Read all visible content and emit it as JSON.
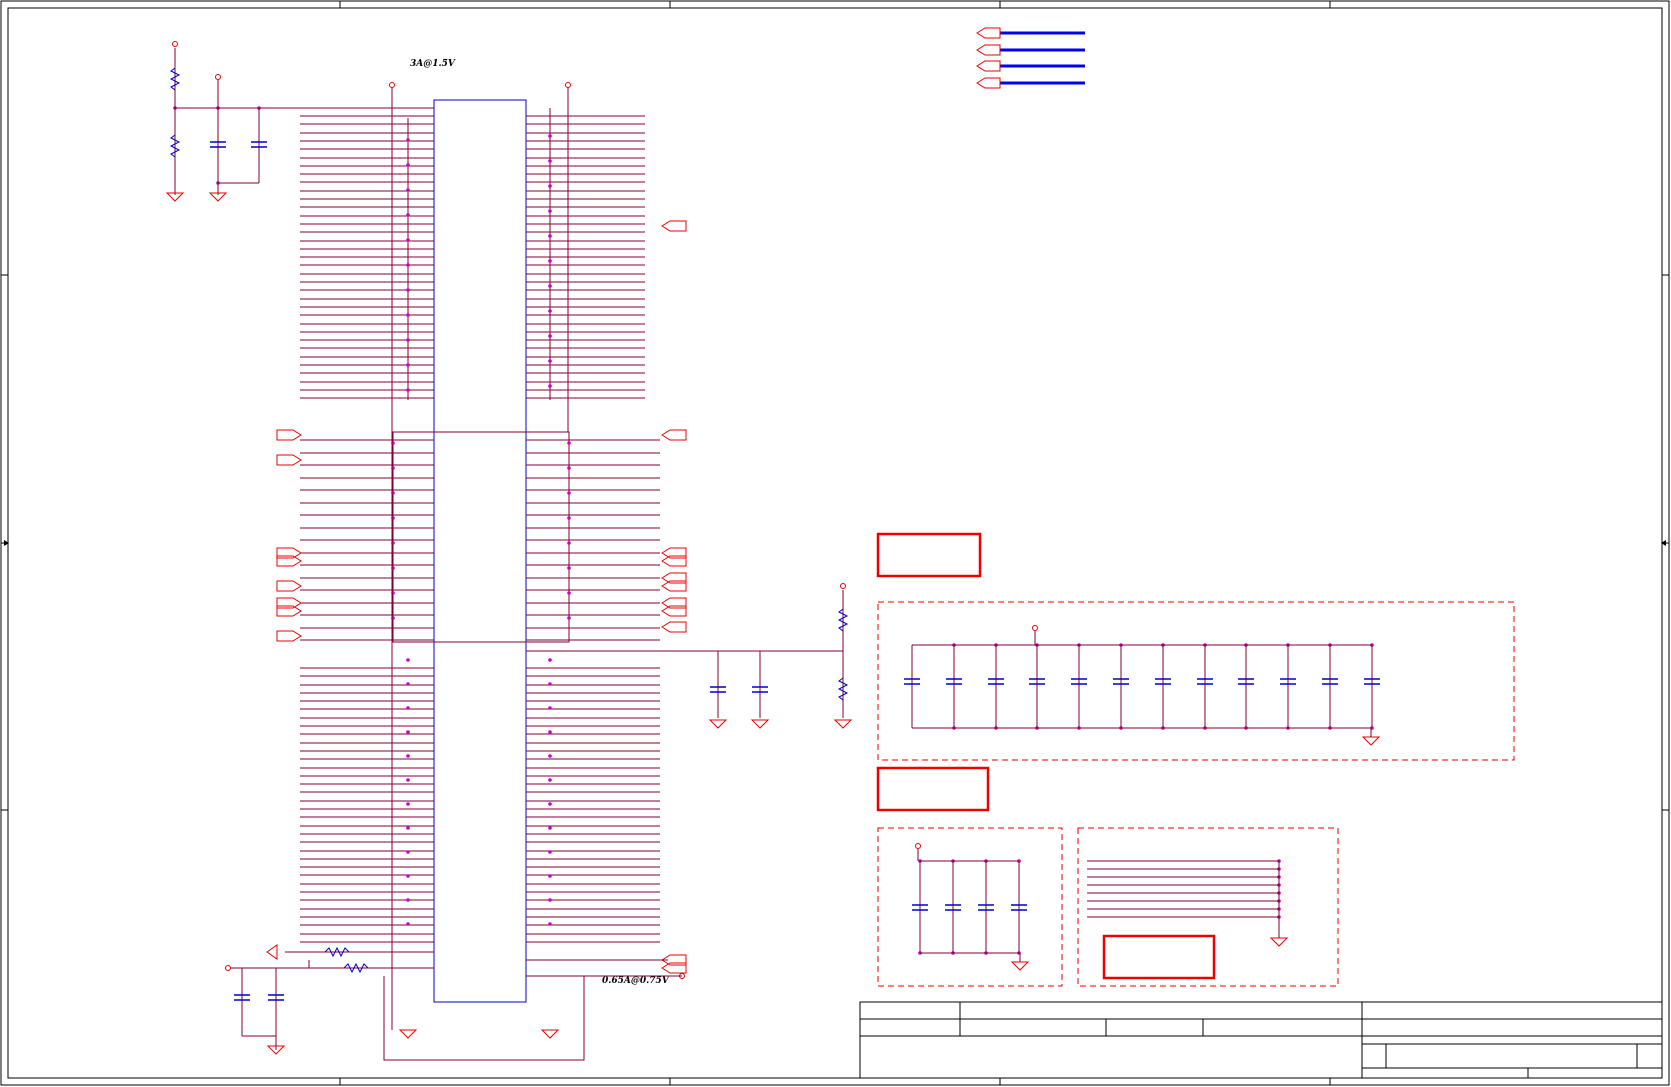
{
  "schematic": {
    "net_labels": {
      "top_rail": "3A@1.5V",
      "bottom_rail": "0.65A@0.75V"
    },
    "colors": {
      "frame": "#000000",
      "wire": "#800033",
      "component": "#0000cc",
      "junction": "#cc00cc",
      "power": "#ee0000",
      "bus": "#0000ee",
      "annotation_box": "#ee0000",
      "dashed_group": "#ee0000"
    },
    "component_counts": {
      "decoupling_caps_row": 12,
      "small_group_caps": 4,
      "bus_lines": 4
    }
  }
}
